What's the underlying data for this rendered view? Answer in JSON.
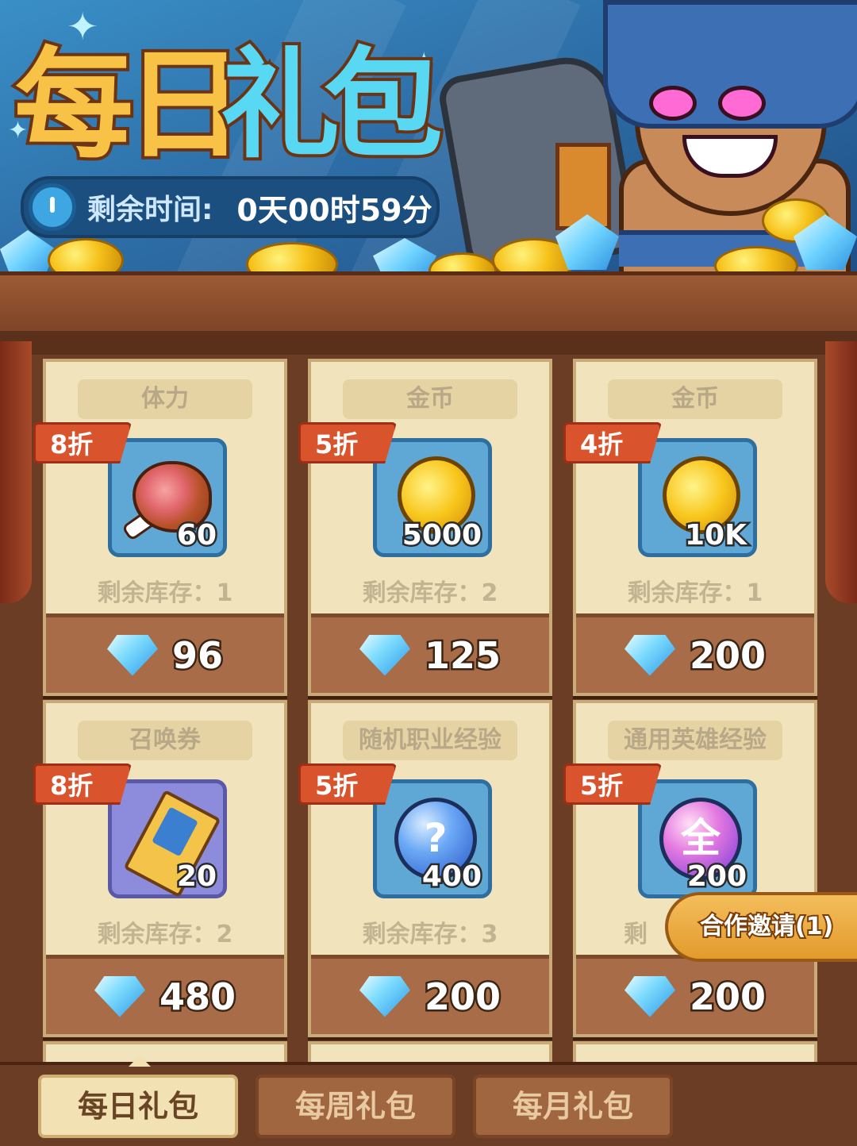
{
  "banner": {
    "title_chars": [
      "每",
      "日",
      "礼",
      "包"
    ],
    "timer_label": "剩余时间:",
    "timer_value": "0天00时59分"
  },
  "cards": [
    {
      "name": "体力",
      "discount": "8折",
      "icon": "meat-icon",
      "quantity": "60",
      "stock": "剩余库存：1",
      "price": "96"
    },
    {
      "name": "金币",
      "discount": "5折",
      "icon": "gold-coin-icon",
      "quantity": "5000",
      "stock": "剩余库存：2",
      "price": "125"
    },
    {
      "name": "金币",
      "discount": "4折",
      "icon": "gold-coin-icon",
      "quantity": "10K",
      "stock": "剩余库存：1",
      "price": "200"
    },
    {
      "name": "召唤券",
      "discount": "8折",
      "icon": "summon-ticket-icon",
      "quantity": "20",
      "stock": "剩余库存：2",
      "price": "480"
    },
    {
      "name": "随机职业经验",
      "discount": "5折",
      "icon": "random-exp-orb-icon",
      "quantity": "400",
      "stock": "剩余库存：3",
      "price": "200"
    },
    {
      "name": "通用英雄经验",
      "discount": "5折",
      "icon": "hero-exp-orb-icon",
      "quantity": "200",
      "stock": "剩",
      "price": "200",
      "orb_text": "全"
    }
  ],
  "orb_labels": {
    "random": "?"
  },
  "invite": {
    "label": "合作邀请(1)"
  },
  "tabs": [
    {
      "label": "每日礼包",
      "active": true
    },
    {
      "label": "每周礼包",
      "active": false
    },
    {
      "label": "每月礼包",
      "active": false
    }
  ],
  "colors": {
    "title_gold": "#f7c245",
    "title_blue": "#58d8f2",
    "discount_red": "#d9532d",
    "card_bg": "#f1e4bc",
    "price_bar": "#a86d48"
  }
}
